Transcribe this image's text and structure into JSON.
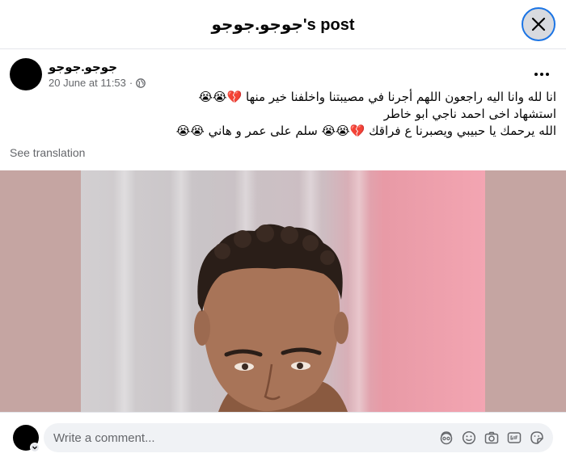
{
  "header": {
    "title": "جوجو.جوجو's post"
  },
  "post": {
    "author": "جوجو.جوجو",
    "timestamp": "20 June at 11:53",
    "separator": "·",
    "text_lines": [
      "انا لله وانا اليه راجعون اللهم أجرنا في مصيبتنا واخلفنا خير منها 💔😭😭",
      "استشهاد اخى احمد ناجي ابو خاطر",
      "الله يرحمك يا حبيبي ويصبرنا ع فراقك 💔😭😭 سلم على عمر و هاني 😭😭"
    ],
    "see_translation": "See translation"
  },
  "comment": {
    "placeholder": "Write a comment..."
  },
  "icons": {
    "close": "close-icon",
    "more": "more-options-icon",
    "privacy": "globe-icon",
    "avatar_sticker": "avatar-sticker-icon",
    "emoji": "emoji-icon",
    "camera": "camera-icon",
    "gif": "gif-icon",
    "sticker": "sticker-icon"
  },
  "colors": {
    "accent": "#1b74e4",
    "secondary_text": "#65676b",
    "input_bg": "#f0f2f5"
  }
}
